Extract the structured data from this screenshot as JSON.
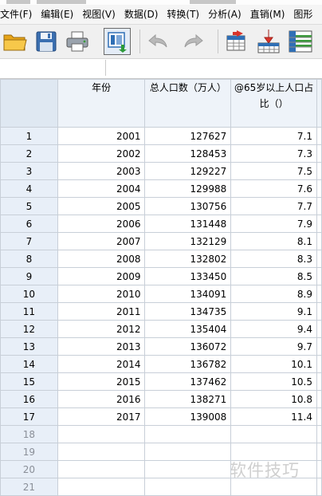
{
  "menu": {
    "items": [
      "文件(F)",
      "编辑(E)",
      "视图(V)",
      "数据(D)",
      "转换(T)",
      "分析(A)",
      "直销(M)",
      "图形"
    ]
  },
  "toolbar": {
    "buttons": [
      "open-folder-icon",
      "save-icon",
      "print-icon",
      "dialog-recall-icon",
      "undo-icon",
      "redo-icon",
      "goto-case-icon",
      "insert-variable-icon",
      "variables-icon"
    ]
  },
  "table": {
    "columns": [
      "年份",
      "总人口数（万人）",
      "@65岁以上人口占比（）"
    ],
    "rows": [
      [
        "1",
        "2001",
        "127627",
        "7.1"
      ],
      [
        "2",
        "2002",
        "128453",
        "7.3"
      ],
      [
        "3",
        "2003",
        "129227",
        "7.5"
      ],
      [
        "4",
        "2004",
        "129988",
        "7.6"
      ],
      [
        "5",
        "2005",
        "130756",
        "7.7"
      ],
      [
        "6",
        "2006",
        "131448",
        "7.9"
      ],
      [
        "7",
        "2007",
        "132129",
        "8.1"
      ],
      [
        "8",
        "2008",
        "132802",
        "8.3"
      ],
      [
        "9",
        "2009",
        "133450",
        "8.5"
      ],
      [
        "10",
        "2010",
        "134091",
        "8.9"
      ],
      [
        "11",
        "2011",
        "134735",
        "9.1"
      ],
      [
        "12",
        "2012",
        "135404",
        "9.4"
      ],
      [
        "13",
        "2013",
        "136072",
        "9.7"
      ],
      [
        "14",
        "2014",
        "136782",
        "10.1"
      ],
      [
        "15",
        "2015",
        "137462",
        "10.5"
      ],
      [
        "16",
        "2016",
        "138271",
        "10.8"
      ],
      [
        "17",
        "2017",
        "139008",
        "11.4"
      ]
    ],
    "empty_rows": [
      "18",
      "19",
      "20",
      "21"
    ]
  },
  "watermark": "软件技巧",
  "colors": {
    "accent_blue": "#2f6fb5",
    "arrow_red": "#d9342b",
    "header_bg": "#eef3f9",
    "rownum_bg": "#e8eff8"
  }
}
